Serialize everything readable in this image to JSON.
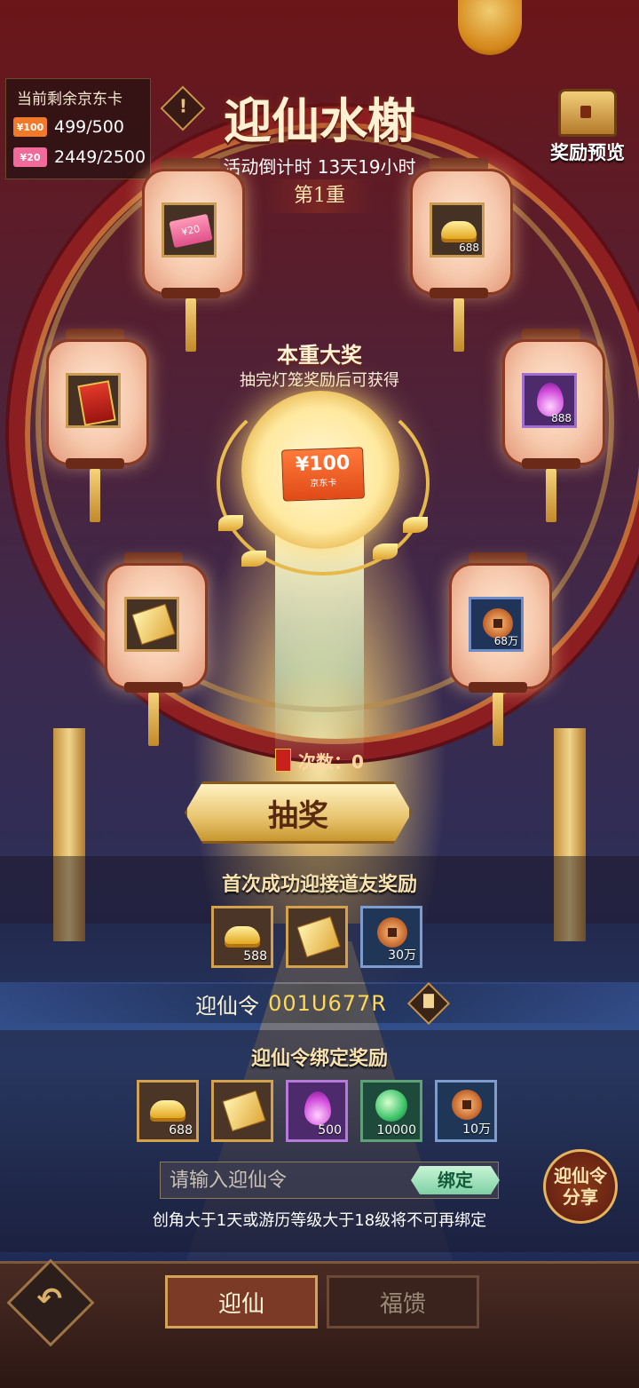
{
  "header": {
    "title": "迎仙水榭",
    "countdown": "活动倒计时 13天19小时",
    "tier": "第1重",
    "info_label": "!",
    "reward_preview_label": "奖励预览"
  },
  "remaining_cards": {
    "title": "当前剩余京东卡",
    "rows": [
      {
        "icon_label": "¥100",
        "value": "499/500",
        "color": "#f07a2a"
      },
      {
        "icon_label": "¥20",
        "value": "2449/2500",
        "color": "#f06a9a"
      }
    ]
  },
  "lanterns": [
    {
      "icon": "jd-card-20-icon",
      "quantity": ""
    },
    {
      "icon": "gold-ingot-icon",
      "quantity": "688"
    },
    {
      "icon": "red-packet-icon",
      "quantity": ""
    },
    {
      "icon": "purple-flame-icon",
      "quantity": "888"
    },
    {
      "icon": "ticket-icon",
      "quantity": ""
    },
    {
      "icon": "copper-coin-icon",
      "quantity": "68万"
    }
  ],
  "grand_prize": {
    "title": "本重大奖",
    "subtitle": "抽完灯笼奖励后可获得",
    "card_value": "¥100",
    "card_caption": "京东卡",
    "card20_label": "¥20"
  },
  "draw": {
    "count_label": "次数：0",
    "button_label": "抽奖"
  },
  "first_reward": {
    "title": "首次成功迎接道友奖励",
    "items": [
      {
        "icon": "gold-ingot-icon",
        "quantity": "588"
      },
      {
        "icon": "ticket-icon",
        "quantity": ""
      },
      {
        "icon": "copper-coin-icon",
        "quantity": "30万"
      }
    ]
  },
  "invite_code": {
    "label": "迎仙令",
    "value": "001U677R"
  },
  "bind_reward": {
    "title": "迎仙令绑定奖励",
    "items": [
      {
        "icon": "gold-ingot-icon",
        "quantity": "688"
      },
      {
        "icon": "ticket-icon",
        "quantity": ""
      },
      {
        "icon": "purple-flame-icon",
        "quantity": "500"
      },
      {
        "icon": "green-orb-icon",
        "quantity": "10000"
      },
      {
        "icon": "copper-coin-icon",
        "quantity": "10万"
      }
    ]
  },
  "bind": {
    "placeholder": "请输入迎仙令",
    "button_label": "绑定",
    "hint": "创角大于1天或游历等级大于18级将不可再绑定",
    "share_label": "迎仙令分享"
  },
  "tabs": [
    {
      "label": "迎仙",
      "active": true
    },
    {
      "label": "福馈",
      "active": false
    }
  ],
  "back_label": "↶"
}
